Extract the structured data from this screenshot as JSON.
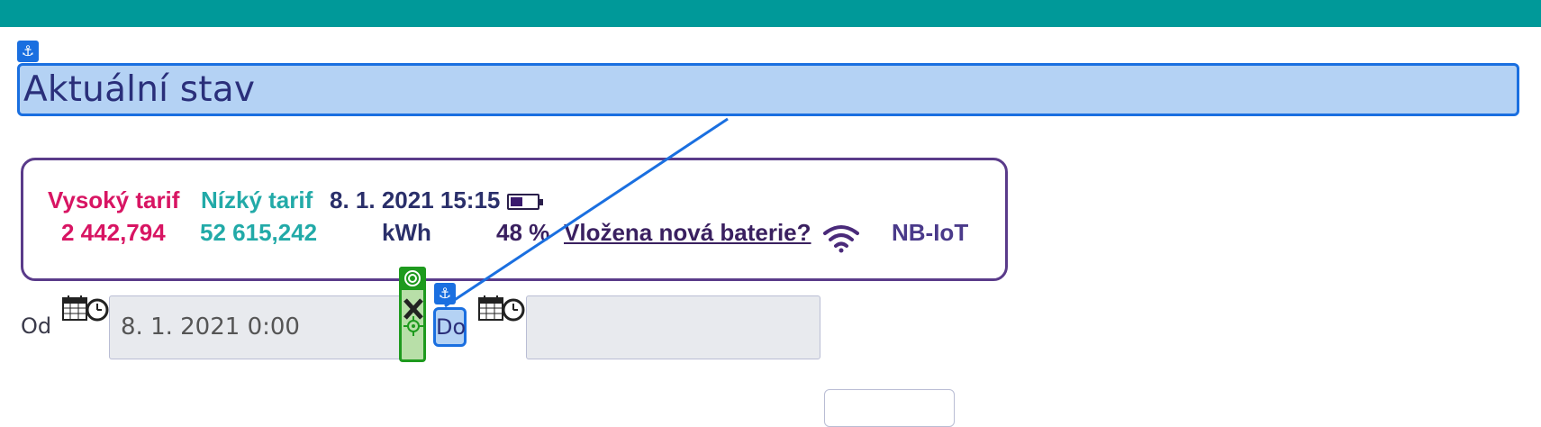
{
  "header": {
    "title": "Aktuální stav"
  },
  "status": {
    "high_tariff_label": "Vysoký tarif",
    "high_tariff_value": "2 442,794",
    "low_tariff_label": "Nízký tarif",
    "low_tariff_value": "52 615,242",
    "timestamp": "8. 1. 2021 15:15",
    "unit": "kWh",
    "battery_percent": "48 %",
    "battery_level": 0.48,
    "new_battery_link": "Vložena nová baterie?",
    "network": "NB-IoT"
  },
  "range": {
    "from_label": "Od",
    "from_value": "8. 1. 2021 0:00",
    "to_label": "Do",
    "to_value": ""
  },
  "colors": {
    "topbar": "#009999",
    "high_tariff": "#d81563",
    "low_tariff": "#22aaa8",
    "card_border": "#5a3b8a",
    "highlight_blue": "#1a6fe0",
    "highlight_green": "#1e9a1e"
  },
  "icons": {
    "anchor": "anchor-icon",
    "battery": "battery-icon",
    "wifi": "wifi-icon",
    "calendar": "calendar-clock-icon",
    "target": "target-icon",
    "close": "close-icon",
    "crosshair": "crosshair-icon"
  }
}
